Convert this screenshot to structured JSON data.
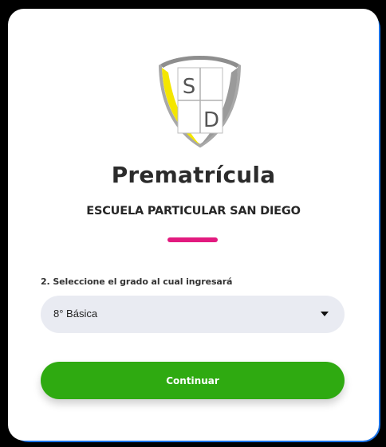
{
  "header": {
    "logo_letters": [
      "S",
      "D"
    ],
    "title": "Prematrícula",
    "subtitle": "ESCUELA PARTICULAR SAN DIEGO"
  },
  "form": {
    "question_label": "2. Seleccione el grado al cual ingresará",
    "grade_select": {
      "selected_value": "8° Básica"
    },
    "continue_label": "Continuar"
  },
  "colors": {
    "accent_bar": "#e21a7f",
    "primary_button": "#2faa11",
    "select_background": "#e9ebf2",
    "frame_edge": "#1a73e8"
  },
  "icons": {
    "logo": "shield-crest-icon",
    "select_caret": "caret-down-icon"
  }
}
